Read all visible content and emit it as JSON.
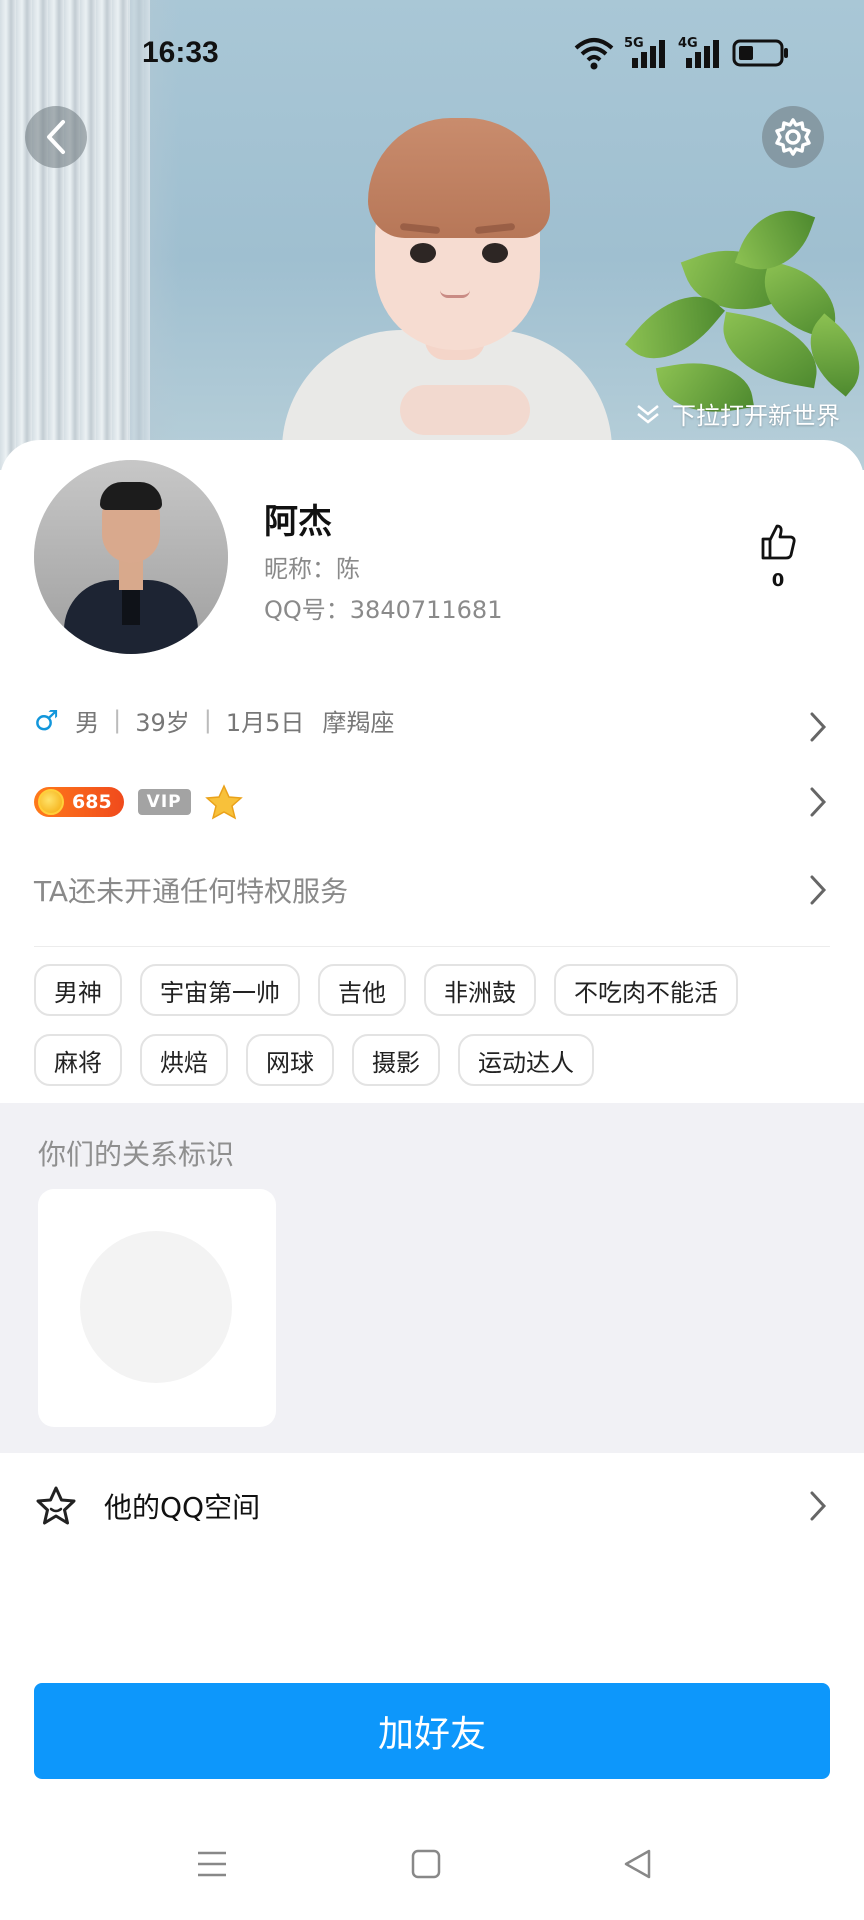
{
  "status_bar": {
    "time": "16:33",
    "network_1": "5G",
    "network_2": "4G",
    "icons": [
      "wifi-icon",
      "signal-5g-icon",
      "signal-4g-icon",
      "battery-icon"
    ]
  },
  "hero": {
    "pull_hint": "下拉打开新世界",
    "back_icon": "chevron-left-icon",
    "settings_icon": "gear-icon"
  },
  "profile": {
    "name": "阿杰",
    "nickname": "昵称：陈",
    "qq_number": "QQ号：3840711681",
    "likes": "0"
  },
  "info": {
    "gender_symbol": "♂",
    "gender": "男",
    "age": "39岁",
    "birthday": "1月5日",
    "zodiac": "摩羯座"
  },
  "badges": {
    "coin_level": "685",
    "vip_label": "VIP"
  },
  "privilege": {
    "text": "TA还未开通任何特权服务"
  },
  "tags": [
    "男神",
    "宇宙第一帅",
    "吉他",
    "非洲鼓",
    "不吃肉不能活",
    "麻将",
    "烘焙",
    "网球",
    "摄影",
    "运动达人"
  ],
  "relation": {
    "title": "你们的关系标识"
  },
  "zone": {
    "label": "他的QQ空间"
  },
  "actions": {
    "add_friend": "加好友"
  },
  "colors": {
    "primary_blue": "#0d97fb",
    "male_blue": "#1296db",
    "coin_orange": "#f04a1c",
    "section_gray": "#f1f1f5"
  }
}
